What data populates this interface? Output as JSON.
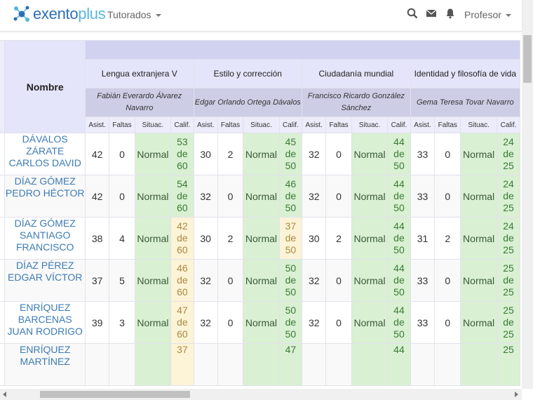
{
  "header": {
    "logo_main": "exento",
    "logo_accent": "plus",
    "nav_label": "Tutorados",
    "user_label": "Profesor"
  },
  "table": {
    "name_header": "Nombre",
    "subjects": [
      {
        "name": "Lengua extranjera V",
        "teacher": "Fabián Everardo Álvarez Navarro"
      },
      {
        "name": "Estilo y corrección",
        "teacher": "Edgar Orlando Ortega Dávalos"
      },
      {
        "name": "Ciudadanía mundial",
        "teacher": "Francisco Ricardo González Sánchez"
      },
      {
        "name": "Identidad y filosofía de vida",
        "teacher": "Gema Teresa Tovar Navarro"
      }
    ],
    "col_headers": [
      "Asist.",
      "Faltas",
      "Situac.",
      "Calif."
    ],
    "rows": [
      {
        "name": "DÁVALOS ZÁRATE CARLOS DAVID",
        "cells": [
          {
            "asist": "42",
            "faltas": "0",
            "situac": "Normal",
            "calif": "53 de 60",
            "flag": "good"
          },
          {
            "asist": "30",
            "faltas": "2",
            "situac": "Normal",
            "calif": "45 de 50",
            "flag": "good"
          },
          {
            "asist": "32",
            "faltas": "0",
            "situac": "Normal",
            "calif": "44 de 50",
            "flag": "good"
          },
          {
            "asist": "33",
            "faltas": "0",
            "situac": "Normal",
            "calif": "24 de 25",
            "flag": "good"
          }
        ]
      },
      {
        "name": "DÍAZ GÓMEZ PEDRO HÉCTOR",
        "cells": [
          {
            "asist": "42",
            "faltas": "0",
            "situac": "Normal",
            "calif": "54 de 60",
            "flag": "good"
          },
          {
            "asist": "32",
            "faltas": "0",
            "situac": "Normal",
            "calif": "46 de 50",
            "flag": "good"
          },
          {
            "asist": "32",
            "faltas": "0",
            "situac": "Normal",
            "calif": "44 de 50",
            "flag": "good"
          },
          {
            "asist": "33",
            "faltas": "0",
            "situac": "Normal",
            "calif": "24 de 25",
            "flag": "good"
          }
        ]
      },
      {
        "name": "DÍAZ GÓMEZ SANTIAGO FRANCISCO",
        "cells": [
          {
            "asist": "38",
            "faltas": "4",
            "situac": "Normal",
            "calif": "42 de 60",
            "flag": "warn"
          },
          {
            "asist": "30",
            "faltas": "2",
            "situac": "Normal",
            "calif": "37 de 50",
            "flag": "warn"
          },
          {
            "asist": "30",
            "faltas": "2",
            "situac": "Normal",
            "calif": "44 de 50",
            "flag": "good"
          },
          {
            "asist": "31",
            "faltas": "2",
            "situac": "Normal",
            "calif": "24 de 25",
            "flag": "good"
          }
        ]
      },
      {
        "name": "DÍAZ PÉREZ EDGAR VÍCTOR",
        "cells": [
          {
            "asist": "37",
            "faltas": "5",
            "situac": "Normal",
            "calif": "46 de 60",
            "flag": "warn"
          },
          {
            "asist": "32",
            "faltas": "0",
            "situac": "Normal",
            "calif": "50 de 50",
            "flag": "good"
          },
          {
            "asist": "32",
            "faltas": "0",
            "situac": "Normal",
            "calif": "44 de 50",
            "flag": "good"
          },
          {
            "asist": "33",
            "faltas": "0",
            "situac": "Normal",
            "calif": "25 de 25",
            "flag": "good"
          }
        ]
      },
      {
        "name": "ENRÍQUEZ BARCENAS JUAN RODRIGO",
        "cells": [
          {
            "asist": "39",
            "faltas": "3",
            "situac": "Normal",
            "calif": "47 de 60",
            "flag": "warn"
          },
          {
            "asist": "32",
            "faltas": "0",
            "situac": "Normal",
            "calif": "50 de 50",
            "flag": "good"
          },
          {
            "asist": "32",
            "faltas": "0",
            "situac": "Normal",
            "calif": "44 de 50",
            "flag": "good"
          },
          {
            "asist": "33",
            "faltas": "0",
            "situac": "Normal",
            "calif": "25 de 25",
            "flag": "good"
          }
        ]
      },
      {
        "name": "ENRÍQUEZ MARTÍNEZ",
        "cells": [
          {
            "asist": "",
            "faltas": "",
            "situac": "",
            "calif": "37",
            "flag": "warn"
          },
          {
            "asist": "",
            "faltas": "",
            "situac": "",
            "calif": "47",
            "flag": "good"
          },
          {
            "asist": "",
            "faltas": "",
            "situac": "",
            "calif": "44",
            "flag": "good"
          },
          {
            "asist": "",
            "faltas": "",
            "situac": "",
            "calif": "25",
            "flag": "good"
          }
        ]
      }
    ]
  },
  "colors": {
    "accent": "#2c6fb5",
    "good": "#d9f0d3",
    "warn": "#fdf3d6",
    "header": "#e4e4fa"
  }
}
